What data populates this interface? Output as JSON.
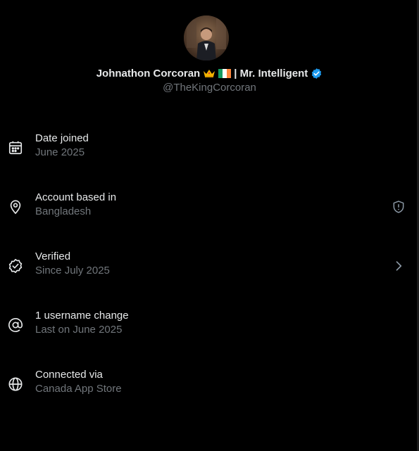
{
  "profile": {
    "name": "Johnathon Corcoran",
    "separator_text": "| Mr. Intelligent",
    "handle": "@TheKingCorcoran",
    "verified_color": "#1d9bf0",
    "crown_icon": "crown-emoji",
    "flag_icon": "ireland-flag-emoji"
  },
  "rows": [
    {
      "title": "Date joined",
      "subtitle": "June 2025",
      "icon": "calendar-icon"
    },
    {
      "title": "Account based in",
      "subtitle": "Bangladesh",
      "icon": "location-pin-icon",
      "action_icon": "shield-alert-icon"
    },
    {
      "title": "Verified",
      "subtitle": "Since July 2025",
      "icon": "verified-badge-outline-icon",
      "action_icon": "chevron-right-icon"
    },
    {
      "title": "1 username change",
      "subtitle": "Last on June 2025",
      "icon": "at-sign-icon"
    },
    {
      "title": "Connected via",
      "subtitle": "Canada App Store",
      "icon": "globe-icon"
    }
  ],
  "colors": {
    "background": "#000000",
    "primary_text": "#e7e9ea",
    "secondary_text": "#71767b",
    "accent": "#1d9bf0"
  }
}
